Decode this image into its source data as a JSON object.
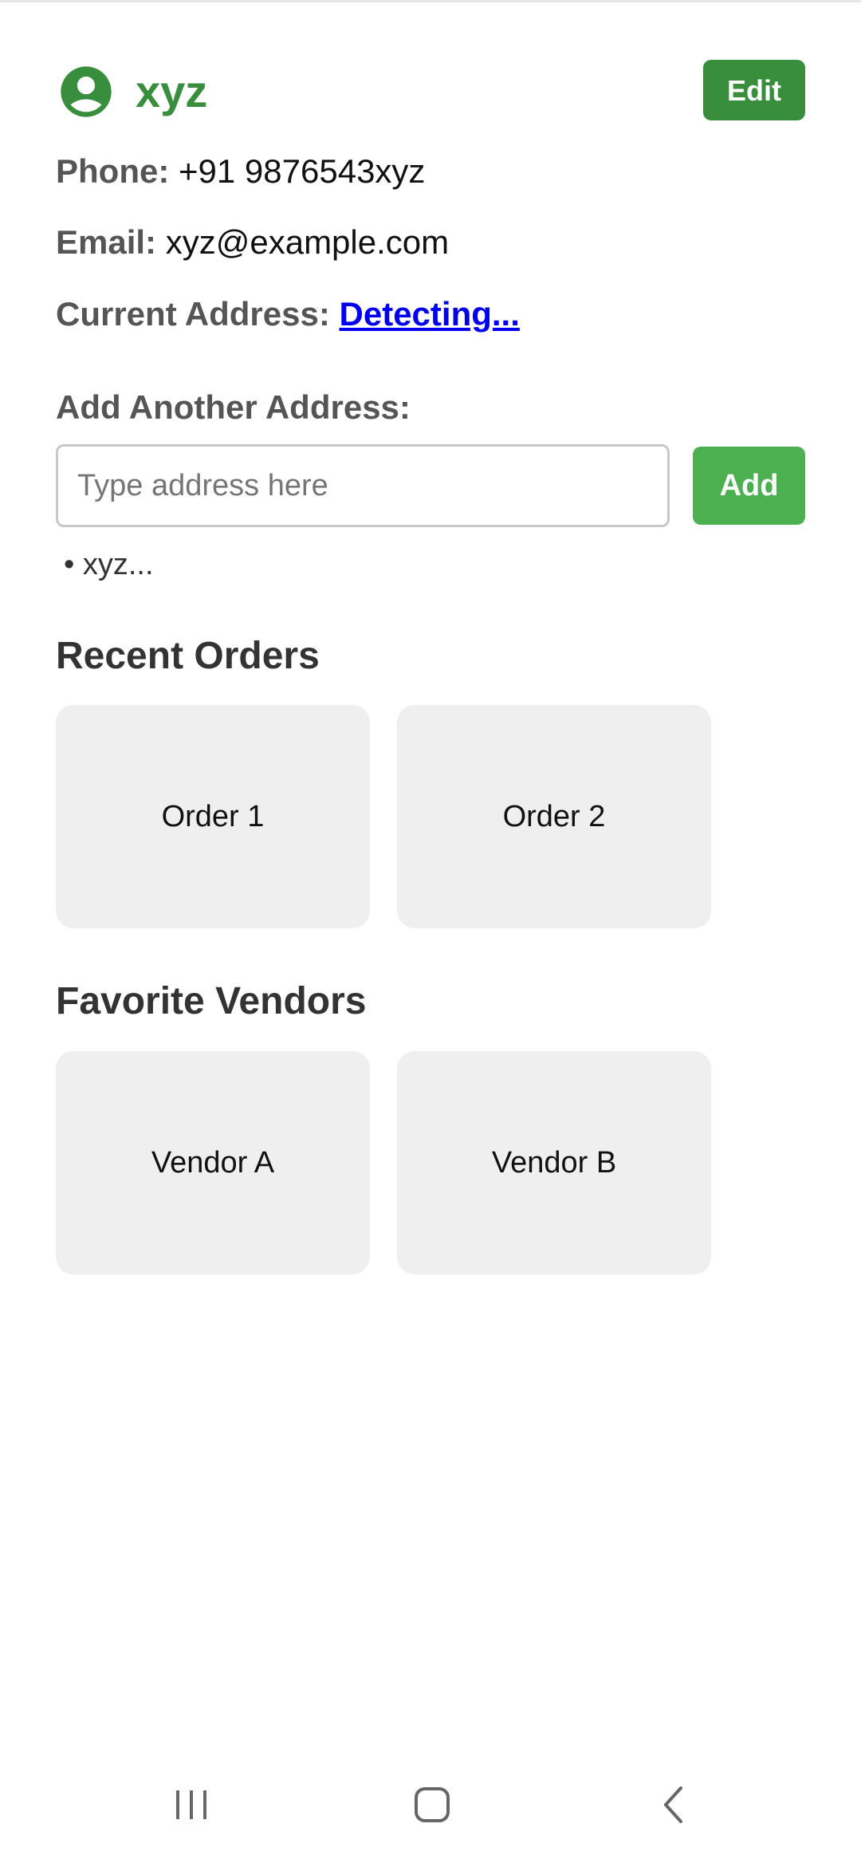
{
  "profile": {
    "name": "xyz",
    "edit_label": "Edit",
    "icon": "account-circle-icon",
    "accent_color": "#388e3c"
  },
  "contact": {
    "phone_label": "Phone:",
    "phone_value": "+91 9876543xyz",
    "email_label": "Email:",
    "email_value": "xyz@example.com",
    "current_address_label": "Current Address:",
    "current_address_value": "Detecting..."
  },
  "add_address": {
    "label": "Add Another Address:",
    "placeholder": "Type address here",
    "value": "",
    "button_label": "Add",
    "button_color": "#4caf50",
    "saved": [
      "• xyz..."
    ]
  },
  "recent_orders": {
    "heading": "Recent Orders",
    "items": [
      "Order 1",
      "Order 2"
    ]
  },
  "favorite_vendors": {
    "heading": "Favorite Vendors",
    "items": [
      "Vendor A",
      "Vendor B"
    ]
  },
  "system_nav": {
    "recents": "recents-icon",
    "home": "home-icon",
    "back": "back-icon"
  }
}
